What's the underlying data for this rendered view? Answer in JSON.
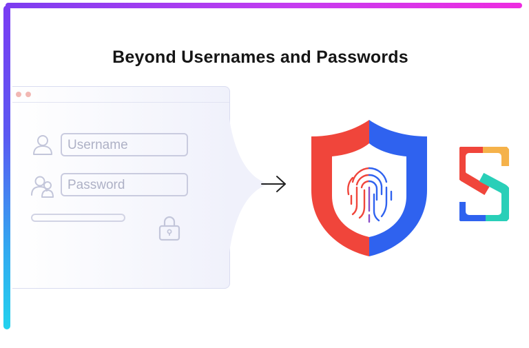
{
  "header": {
    "title": "Beyond Usernames and Passwords"
  },
  "login_form": {
    "username_placeholder": "Username",
    "password_placeholder": "Password"
  },
  "icons": {
    "user": "user-icon",
    "users": "users-icon",
    "lock": "lock-icon",
    "arrow": "arrow-right-icon",
    "shield": "shield-fingerprint-icon",
    "logo": "brand-logo"
  },
  "colors": {
    "shield_left": "#f0453b",
    "shield_right": "#2f62ef",
    "gradient_purple": "#7b3df0",
    "gradient_magenta": "#ee2ce0",
    "gradient_cyan": "#23d2ee"
  }
}
